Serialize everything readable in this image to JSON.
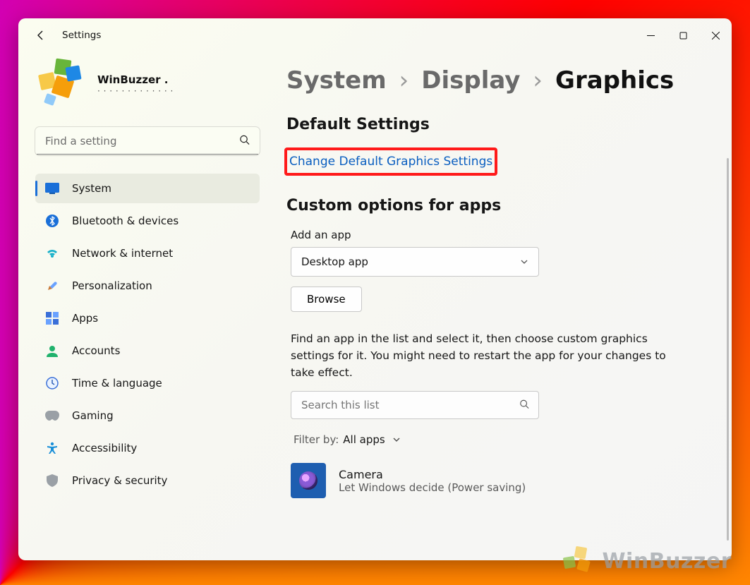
{
  "window": {
    "title": "Settings"
  },
  "profile": {
    "display_name": "WinBuzzer .",
    "subline": "· · · · · · · · · · · · ·"
  },
  "search": {
    "placeholder": "Find a setting"
  },
  "sidebar": {
    "items": [
      {
        "label": "System"
      },
      {
        "label": "Bluetooth & devices"
      },
      {
        "label": "Network & internet"
      },
      {
        "label": "Personalization"
      },
      {
        "label": "Apps"
      },
      {
        "label": "Accounts"
      },
      {
        "label": "Time & language"
      },
      {
        "label": "Gaming"
      },
      {
        "label": "Accessibility"
      },
      {
        "label": "Privacy & security"
      }
    ],
    "selected_index": 0
  },
  "breadcrumbs": {
    "level1": "System",
    "level2": "Display",
    "level3": "Graphics"
  },
  "main": {
    "default_settings_heading": "Default Settings",
    "change_default_link": "Change Default Graphics Settings",
    "custom_heading": "Custom options for apps",
    "add_app_label": "Add an app",
    "app_type_selected": "Desktop app",
    "browse_button": "Browse",
    "description": "Find an app in the list and select it, then choose custom graphics settings for it. You might need to restart the app for your changes to take effect.",
    "list_search_placeholder": "Search this list",
    "filter_label": "Filter by:",
    "filter_value": "All apps",
    "app_list": [
      {
        "name": "Camera",
        "sub": "Let Windows decide (Power saving)"
      }
    ]
  },
  "watermark": {
    "text": "WinBuzzer"
  }
}
